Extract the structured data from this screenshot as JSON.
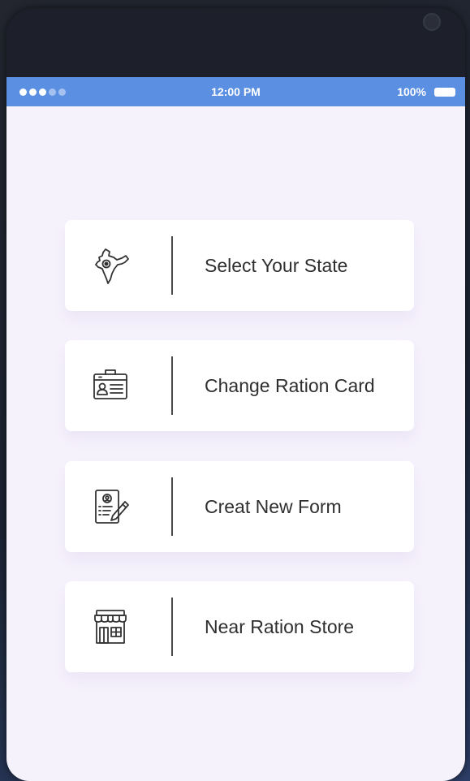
{
  "status_bar": {
    "time": "12:00 PM",
    "battery": "100%"
  },
  "menu": {
    "items": [
      {
        "label": "Select Your State",
        "icon": "india-map-icon"
      },
      {
        "label": "Change Ration Card",
        "icon": "id-card-icon"
      },
      {
        "label": "Creat New Form",
        "icon": "form-edit-icon"
      },
      {
        "label": "Near Ration Store",
        "icon": "store-icon"
      }
    ]
  },
  "colors": {
    "status_bar": "#5b8fe2",
    "content_background": "#f6f2fc",
    "card_background": "#ffffff",
    "text": "#2f2f2f"
  }
}
